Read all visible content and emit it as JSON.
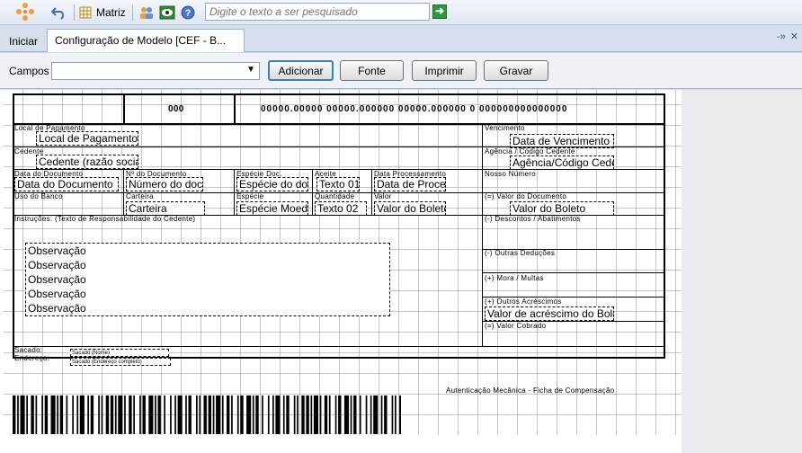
{
  "toolbar": {
    "matriz_label": "Matriz",
    "search_placeholder": "Digite o texto a ser pesquisado"
  },
  "tabs": {
    "iniciar": "Iniciar",
    "config": "Configuração de Modelo [CEF - B..."
  },
  "actions": {
    "campos_label": "Campos",
    "adicionar": "Adicionar",
    "fonte": "Fonte",
    "imprimir": "Imprimir",
    "gravar": "Gravar"
  },
  "boleto": {
    "header": {
      "bank_code": "000",
      "digitable_line": "00000.00000 00000.000000 00000.000000 0 000000000000000"
    },
    "labels": {
      "local_pagamento": "Local de Pagamento",
      "vencimento": "Vencimento",
      "cedente": "Cedente",
      "agencia": "Agência / Código Cedente",
      "data_documento": "Data do Documento",
      "n_documento": "Nº do Documento",
      "especie_doc": "Espécie Doc.",
      "aceite": "Aceite",
      "data_processamento": "Data Processamento",
      "nosso_numero": "Nosso Número",
      "uso_banco": "Uso do Banco",
      "carteira": "Carteira",
      "especie": "Espécie",
      "quantidade": "Quantidade",
      "valor": "Valor",
      "valor_documento": "(=) Valor do Documento",
      "instrucoes": "Instruções: (Texto de Responsabilidade do Cedente)",
      "descontos": "(-) Descontos / Abatimentos",
      "outras_deducoes": "(-) Outras Deduções",
      "mora": "(+) Mora / Multas",
      "outros_acrescimos": "(+) Outros Acréscimos",
      "valor_cobrado": "(=) Valor Cobrado",
      "sacado": "Sacado:",
      "endereco": "Endereço:",
      "autenticacao": "Autenticação Mecânica - Ficha de Compensação"
    },
    "fields": {
      "local_pagamento": "Local de Pagamento",
      "vencimento": "Data de Vencimento",
      "cedente": "Cedente (razão social)",
      "agencia": "Agência/Código Cedente",
      "data_documento": "Data do Documento",
      "n_documento": "Número do documento",
      "especie_doc": "Espécie do documento",
      "aceite": "Texto 01",
      "data_processamento": "Data de Processamento",
      "carteira": "Carteira",
      "especie": "Espécie Moeda",
      "quantidade": "Texto 02",
      "valor": "Valor do Boleto",
      "valor_documento": "Valor do Boleto",
      "observacoes": [
        "Observação",
        "Observação",
        "Observação",
        "Observação",
        "Observação"
      ],
      "valor_acrescimo": "Valor de acréscimo do Boleto",
      "sacado": "Sacado (Nome)",
      "endereco": "Sacado (Endereço completo)"
    }
  }
}
